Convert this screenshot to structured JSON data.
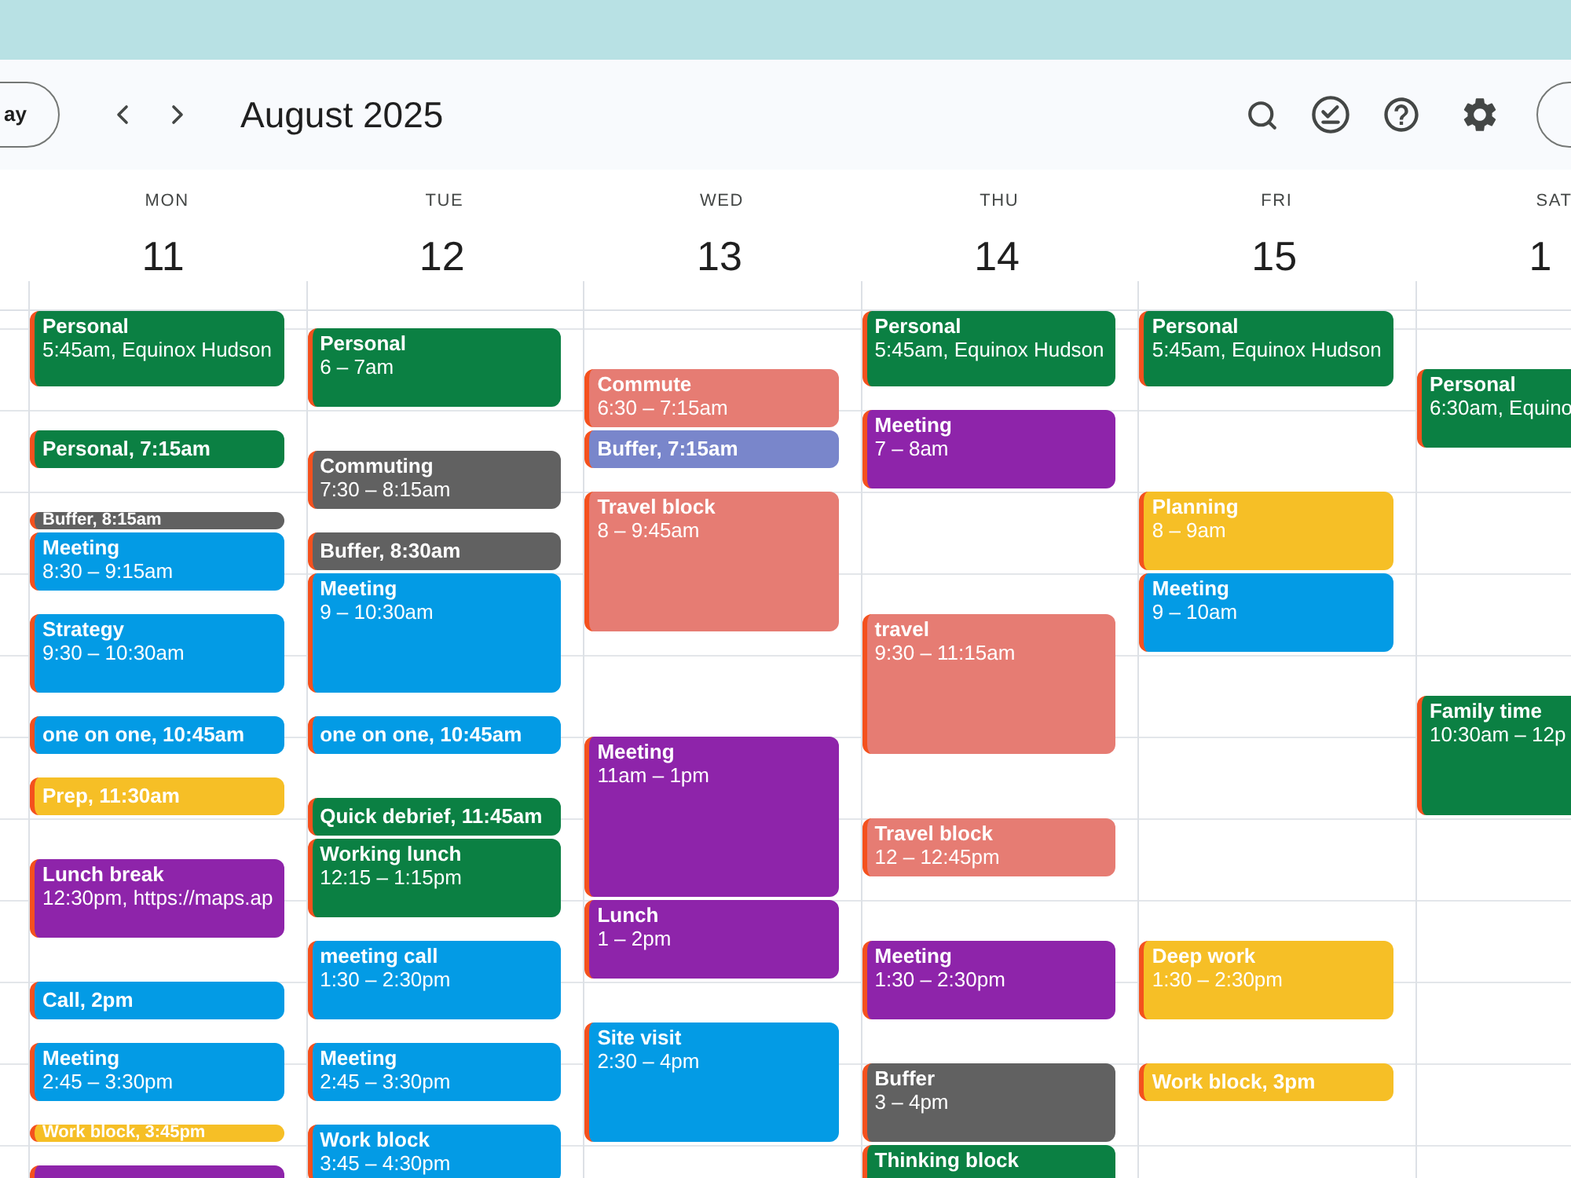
{
  "header": {
    "today_button": "ay",
    "title": "August 2025"
  },
  "days": [
    {
      "name": "MON",
      "number": "11",
      "events": [
        {
          "kind": "full",
          "title": "Personal",
          "time": "5:45am, Equinox Hudson",
          "color": "#0b8043"
        },
        {
          "kind": "compact",
          "title": "Personal, 7:15am",
          "color": "#0b8043"
        },
        {
          "kind": "compact",
          "title": "Buffer, 8:15am",
          "color": "#616161"
        },
        {
          "kind": "full",
          "title": "Meeting",
          "time": "8:30 – 9:15am",
          "color": "#039be5"
        },
        {
          "kind": "full",
          "title": "Strategy",
          "time": "9:30 – 10:30am",
          "color": "#039be5"
        },
        {
          "kind": "compact",
          "title": "one on one, 10:45am",
          "color": "#039be5"
        },
        {
          "kind": "compact",
          "title": "Prep, 11:30am",
          "color": "#f6bf26"
        },
        {
          "kind": "full",
          "title": "Lunch break",
          "time": "12:30pm, https://maps.ap",
          "color": "#8e24aa"
        },
        {
          "kind": "compact",
          "title": "Call, 2pm",
          "color": "#039be5"
        },
        {
          "kind": "full",
          "title": "Meeting",
          "time": "2:45 – 3:30pm",
          "color": "#039be5"
        },
        {
          "kind": "compact",
          "title": "Work block, 3:45pm",
          "color": "#f6bf26"
        },
        {
          "kind": "full",
          "color": "#8e24aa"
        }
      ]
    },
    {
      "name": "TUE",
      "number": "12",
      "events": [
        {
          "kind": "full",
          "title": "Personal",
          "time": "6 – 7am",
          "color": "#0b8043"
        },
        {
          "kind": "full",
          "title": "Commuting",
          "time": "7:30 – 8:15am",
          "color": "#616161"
        },
        {
          "kind": "compact",
          "title": "Buffer, 8:30am",
          "color": "#616161"
        },
        {
          "kind": "full",
          "title": "Meeting",
          "time": "9 – 10:30am",
          "color": "#039be5"
        },
        {
          "kind": "compact",
          "title": "one on one, 10:45am",
          "color": "#039be5"
        },
        {
          "kind": "compact",
          "title": "Quick debrief, 11:45am",
          "color": "#0b8043"
        },
        {
          "kind": "full",
          "title": "Working lunch",
          "time": "12:15 – 1:15pm",
          "color": "#0b8043"
        },
        {
          "kind": "full",
          "title": "meeting call",
          "time": "1:30 – 2:30pm",
          "color": "#039be5"
        },
        {
          "kind": "full",
          "title": "Meeting",
          "time": "2:45 – 3:30pm",
          "color": "#039be5"
        },
        {
          "kind": "full",
          "title": "Work block",
          "time": "3:45 – 4:30pm",
          "color": "#039be5"
        }
      ]
    },
    {
      "name": "WED",
      "number": "13",
      "events": [
        {
          "kind": "full",
          "title": "Commute",
          "time": "6:30 – 7:15am",
          "color": "#e67c73"
        },
        {
          "kind": "compact",
          "title": "Buffer, 7:15am",
          "color": "#7986cb"
        },
        {
          "kind": "full",
          "title": "Travel block",
          "time": "8 – 9:45am",
          "color": "#e67c73"
        },
        {
          "kind": "full",
          "title": "Meeting",
          "time": "11am – 1pm",
          "color": "#8e24aa"
        },
        {
          "kind": "full",
          "title": "Lunch",
          "time": "1 – 2pm",
          "color": "#8e24aa"
        },
        {
          "kind": "full",
          "title": "Site visit",
          "time": "2:30 – 4pm",
          "color": "#039be5"
        }
      ]
    },
    {
      "name": "THU",
      "number": "14",
      "events": [
        {
          "kind": "full",
          "title": "Personal",
          "time": "5:45am, Equinox Hudson",
          "color": "#0b8043"
        },
        {
          "kind": "full",
          "title": "Meeting",
          "time": "7 – 8am",
          "color": "#8e24aa"
        },
        {
          "kind": "full",
          "title": "travel",
          "time": "9:30 – 11:15am",
          "color": "#e67c73"
        },
        {
          "kind": "full",
          "title": "Travel block",
          "time": "12 – 12:45pm",
          "color": "#e67c73"
        },
        {
          "kind": "full",
          "title": "Meeting",
          "time": "1:30 – 2:30pm",
          "color": "#8e24aa"
        },
        {
          "kind": "full",
          "title": "Buffer",
          "time": "3 – 4pm",
          "color": "#616161"
        },
        {
          "kind": "full",
          "title": "Thinking block",
          "color": "#0b8043"
        }
      ]
    },
    {
      "name": "FRI",
      "number": "15",
      "events": [
        {
          "kind": "full",
          "title": "Personal",
          "time": "5:45am, Equinox Hudson",
          "color": "#0b8043"
        },
        {
          "kind": "full",
          "title": "Planning",
          "time": "8 – 9am",
          "color": "#f6bf26"
        },
        {
          "kind": "full",
          "title": "Meeting",
          "time": "9 – 10am",
          "color": "#039be5"
        },
        {
          "kind": "full",
          "title": "Deep work",
          "time": "1:30 – 2:30pm",
          "color": "#f6bf26"
        },
        {
          "kind": "compact",
          "title": "Work block, 3pm",
          "color": "#f6bf26"
        }
      ]
    },
    {
      "name": "SAT",
      "number": "1",
      "events": [
        {
          "kind": "full",
          "title": "Personal",
          "time": "6:30am, Equino",
          "color": "#0b8043"
        },
        {
          "kind": "full",
          "title": "Family time",
          "time": "10:30am – 12p",
          "color": "#0b8043"
        }
      ]
    }
  ]
}
